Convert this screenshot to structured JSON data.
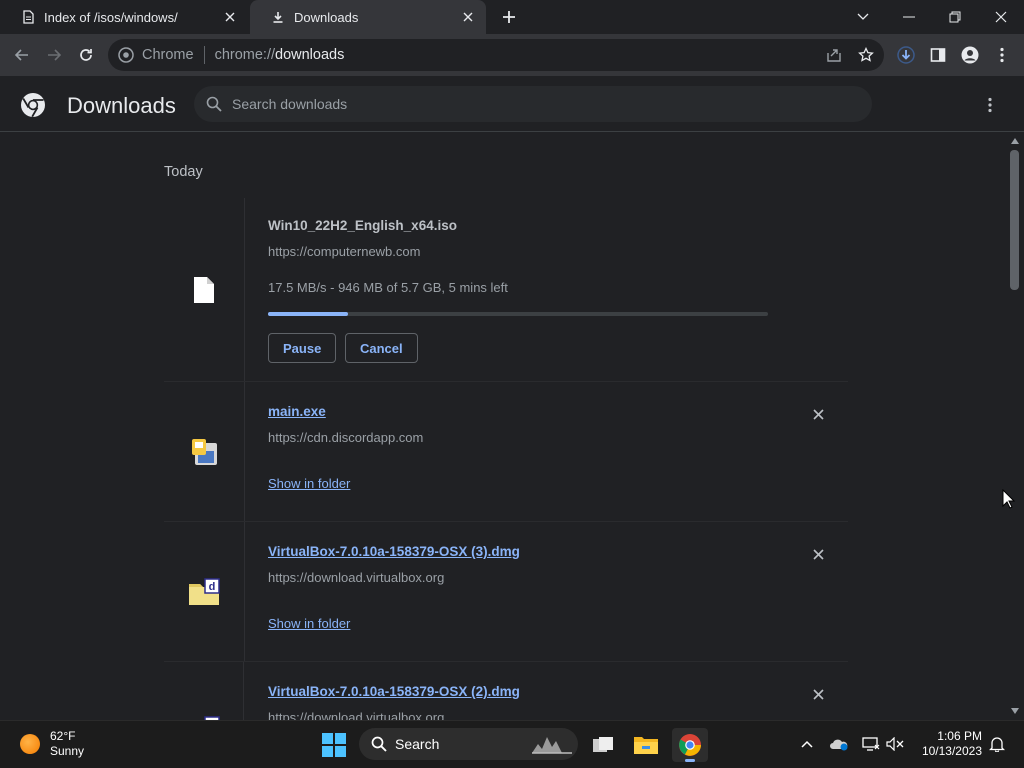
{
  "tabs": [
    {
      "title": "Index of /isos/windows/",
      "active": false,
      "icon": "page-icon"
    },
    {
      "title": "Downloads",
      "active": true,
      "icon": "download-icon"
    }
  ],
  "toolbar": {
    "site_label": "Chrome",
    "url_scheme": "chrome://",
    "url_host": "downloads"
  },
  "page": {
    "title": "Downloads",
    "search_placeholder": "Search downloads"
  },
  "downloads": {
    "section": "Today",
    "items": [
      {
        "filename": "Win10_22H2_English_x64.iso",
        "url": "https://computernewb.com",
        "status": "17.5 MB/s - 946 MB of 5.7 GB, 5 mins left",
        "progress": 0.16,
        "pause_label": "Pause",
        "cancel_label": "Cancel"
      },
      {
        "filename": "main.exe",
        "url": "https://cdn.discordapp.com",
        "action": "Show in folder"
      },
      {
        "filename": "VirtualBox-7.0.10a-158379-OSX (3).dmg",
        "url": "https://download.virtualbox.org",
        "action": "Show in folder"
      },
      {
        "filename": "VirtualBox-7.0.10a-158379-OSX (2).dmg",
        "url": "https://download.virtualbox.org"
      }
    ]
  },
  "taskbar": {
    "weather_temp": "62°F",
    "weather_desc": "Sunny",
    "search_label": "Search",
    "time": "1:06 PM",
    "date": "10/13/2023"
  },
  "colors": {
    "accent": "#8ab4f8",
    "background": "#202124",
    "toolbar": "#35363a"
  }
}
